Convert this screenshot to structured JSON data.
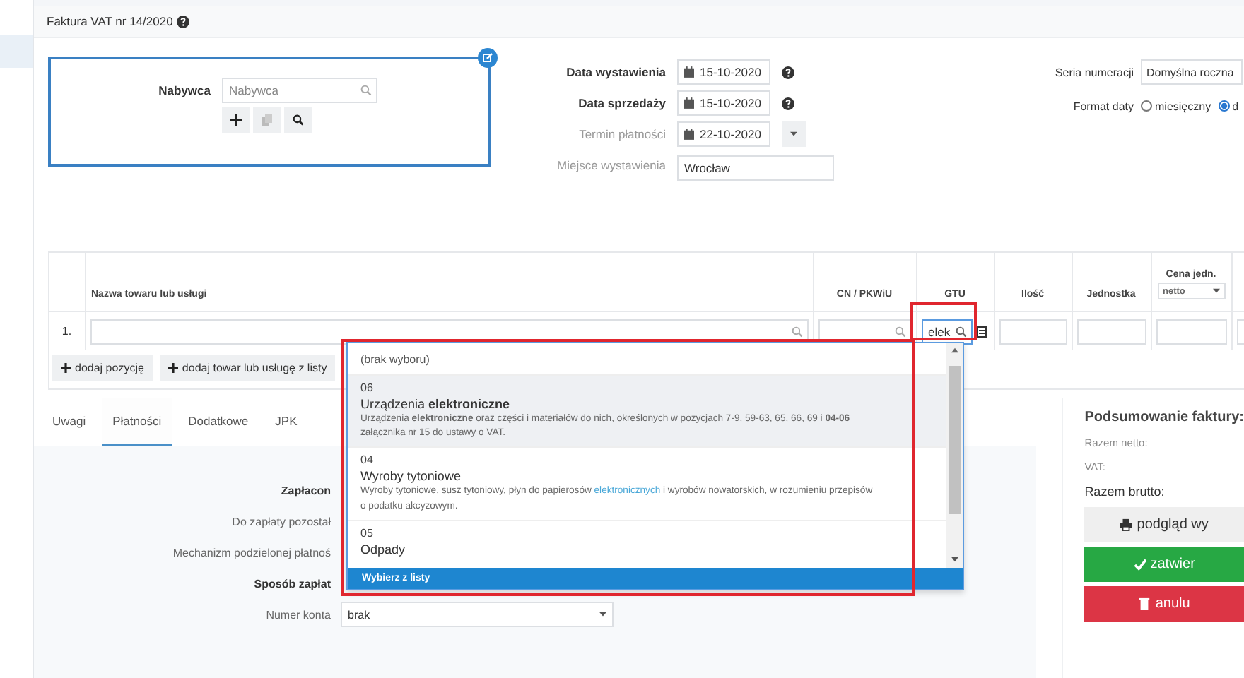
{
  "invoice": {
    "title": "Faktura VAT nr 14/2020"
  },
  "buyer": {
    "label": "Nabywca",
    "placeholder": "Nabywca"
  },
  "dates": [
    {
      "label": "Data wystawienia",
      "value": "15-10-2020",
      "kind": "date_help",
      "strong": true
    },
    {
      "label": "Data sprzedaży",
      "value": "15-10-2020",
      "kind": "date_help",
      "strong": true
    },
    {
      "label": "Termin płatności",
      "value": "22-10-2020",
      "kind": "date_menu",
      "strong": false
    },
    {
      "label": "Miejsce wystawienia",
      "value": "Wrocław",
      "kind": "text",
      "strong": false
    }
  ],
  "numbering": {
    "label": "Seria numeracji",
    "value": "Domyślna roczna"
  },
  "date_format": {
    "label": "Format daty",
    "options": [
      {
        "label": "miesięczny",
        "selected": false
      },
      {
        "label": "d",
        "selected": true
      }
    ]
  },
  "items_table": {
    "columns": [
      {
        "label": "Nazwa towaru lub usługi"
      },
      {
        "label": "CN / PKWiU"
      },
      {
        "label": "GTU"
      },
      {
        "label": "Ilość"
      },
      {
        "label": "Jednostka"
      },
      {
        "label": "Cena jedn.",
        "select": "netto"
      }
    ],
    "rows": [
      {
        "index": "1.",
        "gtu": "elek"
      }
    ]
  },
  "add_buttons": [
    "dodaj pozycję",
    "dodaj towar lub usługę z listy"
  ],
  "tabs": [
    {
      "label": "Uwagi",
      "selected": false
    },
    {
      "label": "Płatności",
      "selected": true
    },
    {
      "label": "Dodatkowe",
      "selected": false
    },
    {
      "label": "JPK",
      "selected": false
    }
  ],
  "payment_form": [
    {
      "label": "Zapłacon",
      "strong": true
    },
    {
      "label": "Do zapłaty pozostał",
      "strong": false
    },
    {
      "label": "Mechanizm podzielonej płatnoś",
      "strong": false
    },
    {
      "label": "Sposób zapłat",
      "strong": true
    },
    {
      "label": "Numer konta",
      "strong": false,
      "value": "brak"
    }
  ],
  "summary": {
    "title": "Podsumowanie faktury:",
    "rows": [
      {
        "label": "Razem netto:",
        "strong": false
      },
      {
        "label": "VAT:",
        "strong": false
      },
      {
        "label": "Razem brutto:",
        "strong": true
      }
    ],
    "buttons": [
      {
        "kind": "preview",
        "label": "podgląd wy"
      },
      {
        "kind": "confirm",
        "label": "zatwier"
      },
      {
        "kind": "cancel",
        "label": "anulu"
      }
    ]
  },
  "gtu_dropdown": {
    "empty_option": "(brak wyboru)",
    "options": [
      {
        "code": "06",
        "name": "Urządzenia **elektroniczne**",
        "selected": true,
        "description": [
          {
            "kind": "plain",
            "text": "Urządzenia "
          },
          {
            "kind": "bold",
            "text": "elektroniczne"
          },
          {
            "kind": "plain",
            "text": " oraz części i materiałów do nich, określonych w pozycjach 7-9, 59-63, 65, 66, 69 i "
          },
          {
            "kind": "bold",
            "text": "04-06"
          },
          {
            "kind": "plain",
            "text": " załącznika nr 15 do ustawy o VAT."
          }
        ]
      },
      {
        "code": "04",
        "name": "Wyroby tytoniowe",
        "selected": false,
        "description": [
          {
            "kind": "plain",
            "text": "Wyroby tytoniowe, susz tytoniowy, płyn do papierosów "
          },
          {
            "kind": "link",
            "text": "elektronicznych"
          },
          {
            "kind": "plain",
            "text": " i wyrobów nowatorskich, w rozumieniu przepisów o podatku akcyzowym."
          }
        ]
      },
      {
        "code": "05",
        "name": "Odpady",
        "selected": false
      }
    ],
    "footer": "Wybierz z listy"
  }
}
